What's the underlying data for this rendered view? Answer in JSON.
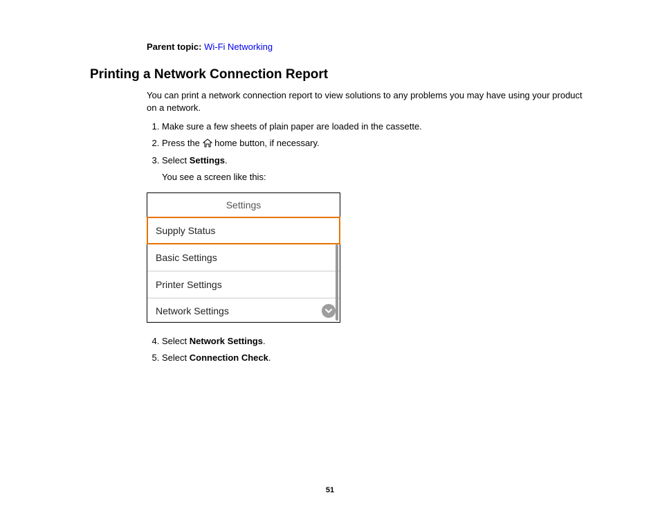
{
  "parentTopic": {
    "label": "Parent topic:",
    "link": "Wi-Fi Networking"
  },
  "title": "Printing a Network Connection Report",
  "intro": "You can print a network connection report to view solutions to any problems you may have using your product on a network.",
  "steps": {
    "s1": "Make sure a few sheets of plain paper are loaded in the cassette.",
    "s2a": "Press the ",
    "s2b": " home button, if necessary.",
    "s3a": "Select ",
    "s3b": "Settings",
    "s3c": ".",
    "s3note": "You see a screen like this:",
    "s4a": "Select ",
    "s4b": "Network Settings",
    "s4c": ".",
    "s5a": "Select ",
    "s5b": "Connection Check",
    "s5c": "."
  },
  "screen": {
    "header": "Settings",
    "items": [
      "Supply Status",
      "Basic Settings",
      "Printer Settings",
      "Network Settings"
    ]
  },
  "pageNumber": "51"
}
